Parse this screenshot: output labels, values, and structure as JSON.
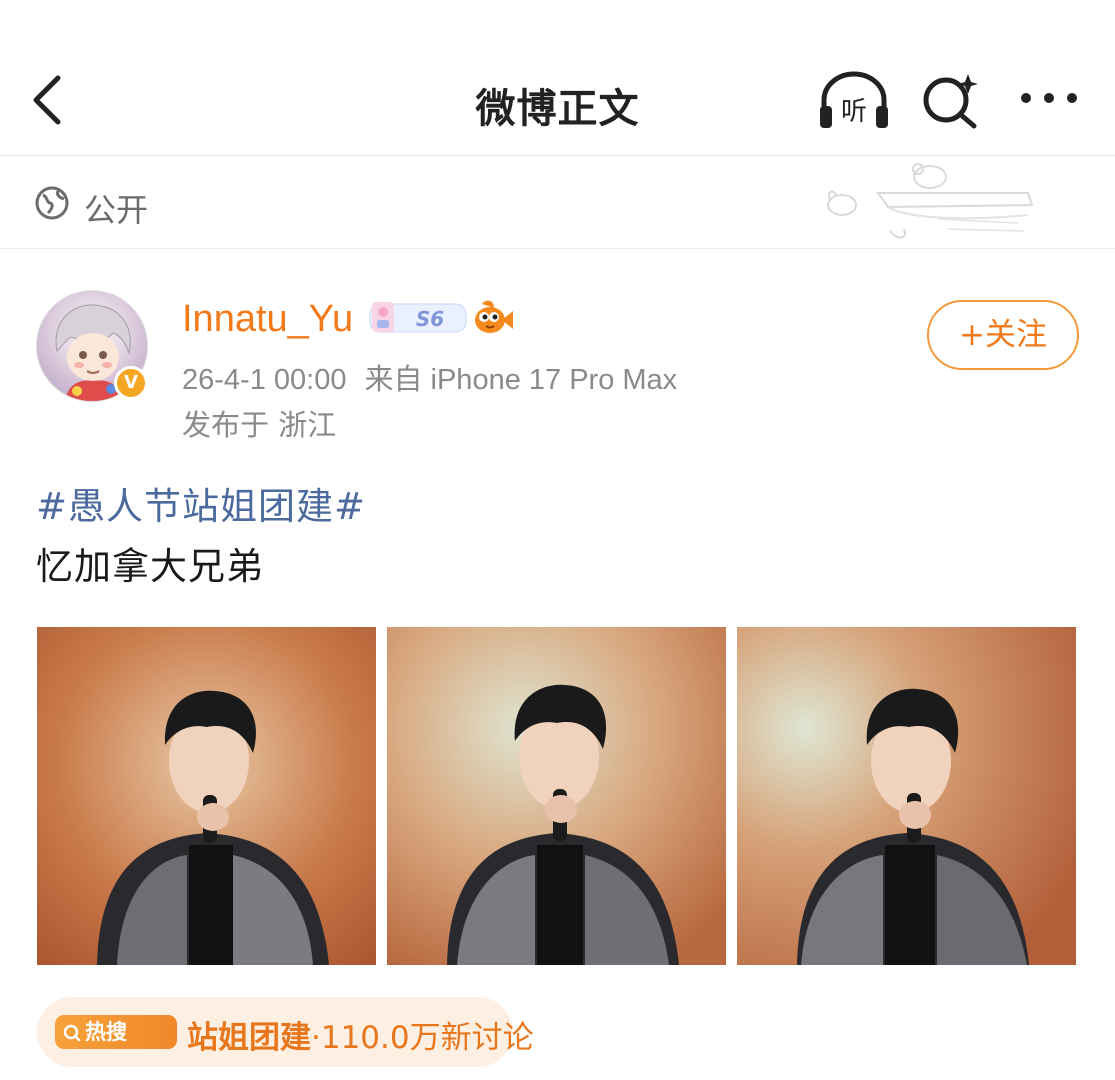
{
  "header": {
    "title": "微博正文",
    "listen_label": "听"
  },
  "visibility": {
    "label": "公开"
  },
  "post": {
    "author": {
      "name": "Innatu_Yu",
      "verified_mark": "V",
      "level_badge": "S6"
    },
    "timestamp": "26-4-1 00:00",
    "source": "来自 iPhone 17 Pro Max",
    "location": "发布于 浙江",
    "follow_label": "+关注",
    "hashtag": "#愚人节站姐团建#",
    "text": "忆加拿大兄弟",
    "photo_count": 3
  },
  "hot_search": {
    "tag_label": "热搜",
    "topic": "站姐团建",
    "stats": "·110.0万新讨论"
  },
  "colors": {
    "accent_orange": "#f27a1a",
    "hashtag_blue": "#4c6a9d",
    "meta_gray": "#8a8a8a"
  }
}
